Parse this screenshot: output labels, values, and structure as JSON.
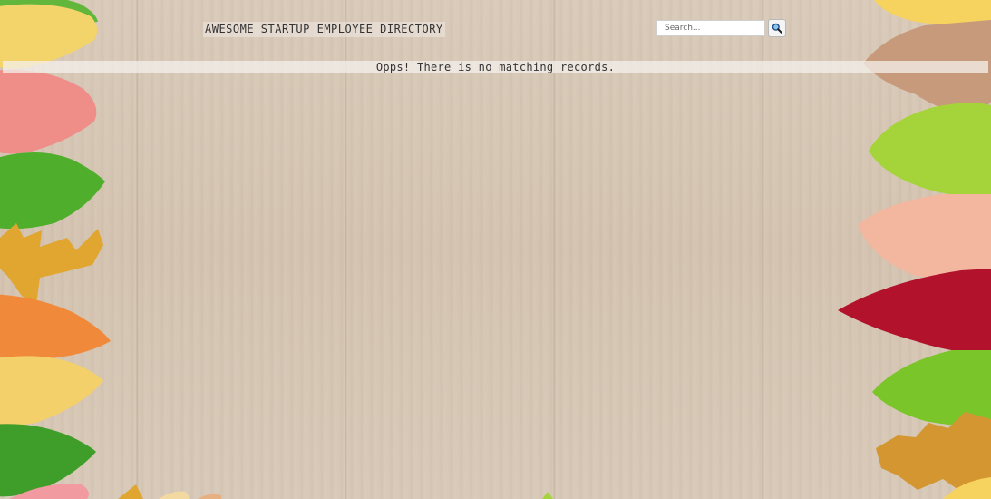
{
  "header": {
    "title": "AWESOME STARTUP EMPLOYEE DIRECTORY"
  },
  "search": {
    "placeholder": "Search...",
    "value": "",
    "button_icon": "magnifier-icon"
  },
  "results": {
    "empty_message": "Opps! There is no matching records."
  },
  "colors": {
    "wood_background": "#d8c8b6",
    "leaf_yellow": "#f2d46a",
    "leaf_pink": "#ef8f8f",
    "leaf_green": "#58b83a",
    "leaf_orange": "#f08a3a",
    "leaf_red": "#b3122c",
    "leaf_tan": "#c9a083"
  }
}
